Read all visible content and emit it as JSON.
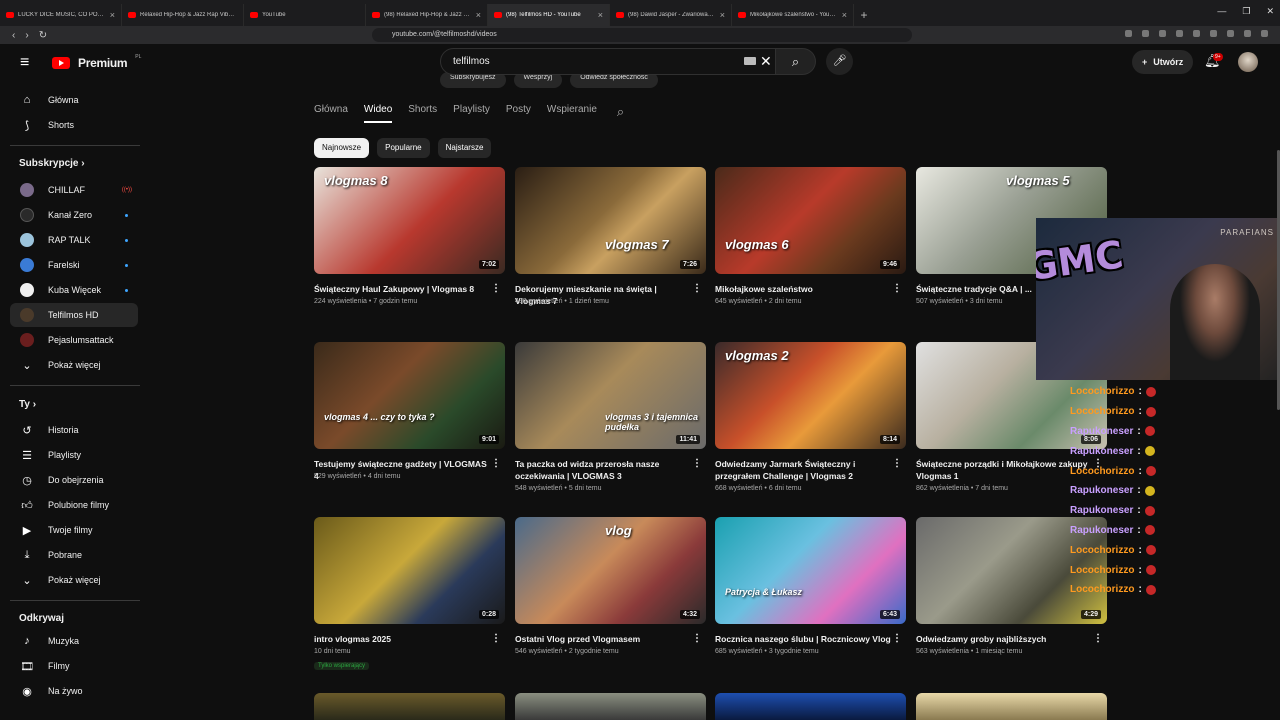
{
  "browser": {
    "tabs": [
      {
        "title": "LUCKY DICE MUSIC, CO POSZŁO NIE TAK"
      },
      {
        "title": "Relaxed Hip-Hop & Jazz Rap Vibes / Lo-fi"
      },
      {
        "title": "YouTube"
      },
      {
        "title": "(98) Relaxed Hip-Hop & Jazz Rap Vibes"
      },
      {
        "title": "(98) Telfilmos HD - YouTube"
      },
      {
        "title": "(98) Dawid Jasper - Zwariowana Noc"
      },
      {
        "title": "Mikołajkowe szaleństwo - YouTube"
      }
    ],
    "url": "youtube.com/@telfilmoshd/videos"
  },
  "header": {
    "brand": "Premium",
    "country": "PL",
    "search_value": "telfilmos",
    "create_label": "Utwórz",
    "notif_count": "9+"
  },
  "channel_actions": [
    "Subskrybujesz",
    "Wesprzyj",
    "Odwiedź społeczność"
  ],
  "sidebar": {
    "main": [
      {
        "label": "Główna",
        "icon": "home-icon"
      },
      {
        "label": "Shorts",
        "icon": "shorts-icon"
      }
    ],
    "subs_header": "Subskrypcje",
    "subs": [
      {
        "label": "CHILLAF",
        "color": "#7a6a8a",
        "status": "live"
      },
      {
        "label": "Kanał Zero",
        "color": "#2a2a2a",
        "status": "new"
      },
      {
        "label": "RAP TALK",
        "color": "#9cc4dc",
        "status": "new"
      },
      {
        "label": "Farelski",
        "color": "#3a7bd5",
        "status": "new"
      },
      {
        "label": "Kuba Więcek",
        "color": "#f0f0f0",
        "status": "new"
      },
      {
        "label": "Telfilmos HD",
        "color": "#4a3a2a",
        "status": ""
      },
      {
        "label": "Pejaslumsattack",
        "color": "#6a1e1e",
        "status": ""
      },
      {
        "label": "Pokaż więcej",
        "color": "",
        "status": ""
      }
    ],
    "you_header": "Ty",
    "you": [
      {
        "label": "Historia",
        "icon": "history-icon"
      },
      {
        "label": "Playlisty",
        "icon": "playlist-icon"
      },
      {
        "label": "Do obejrzenia",
        "icon": "watch-later-icon"
      },
      {
        "label": "Polubione filmy",
        "icon": "like-icon"
      },
      {
        "label": "Twoje filmy",
        "icon": "your-videos-icon"
      },
      {
        "label": "Pobrane",
        "icon": "download-icon"
      },
      {
        "label": "Pokaż więcej",
        "icon": "chevron-down-icon"
      }
    ],
    "explore_header": "Odkrywaj",
    "explore": [
      {
        "label": "Muzyka",
        "icon": "music-icon"
      },
      {
        "label": "Filmy",
        "icon": "film-icon"
      },
      {
        "label": "Na żywo",
        "icon": "live-icon"
      }
    ]
  },
  "channel_tabs": [
    "Główna",
    "Wideo",
    "Shorts",
    "Playlisty",
    "Posty",
    "Wspieranie"
  ],
  "filters": [
    "Najnowsze",
    "Popularne",
    "Najstarsze"
  ],
  "videos": [
    {
      "title": "Świąteczny Haul Zakupowy | Vlogmas 8",
      "views": "224 wyświetlenia",
      "age": "7 godzin temu",
      "duration": "7:02",
      "overlay": "vlogmas 8"
    },
    {
      "title": "Dekorujemy mieszkanie na święta | Vlogmas 7",
      "views": "430 wyświetleń",
      "age": "1 dzień temu",
      "duration": "7:26",
      "overlay": "vlogmas 7"
    },
    {
      "title": "Mikołajkowe szaleństwo",
      "views": "645 wyświetleń",
      "age": "2 dni temu",
      "duration": "9:46",
      "overlay": "vlogmas 6"
    },
    {
      "title": "Świąteczne tradycje Q&A | ...",
      "views": "507 wyświetleń",
      "age": "3 dni temu",
      "duration": "",
      "overlay": "vlogmas 5"
    },
    {
      "title": "Testujemy świąteczne gadżety | VLOGMAS 4",
      "views": "529 wyświetleń",
      "age": "4 dni temu",
      "duration": "9:01",
      "overlay": "vlogmas 4 ... czy to tyka ?"
    },
    {
      "title": "Ta paczka od widza przerosła nasze oczekiwania | VLOGMAS 3",
      "views": "548 wyświetleń",
      "age": "5 dni temu",
      "duration": "11:41",
      "overlay": "vlogmas 3 i tajemnica pudełka"
    },
    {
      "title": "Odwiedzamy Jarmark Świąteczny i przegrałem Challenge | Vlogmas 2",
      "views": "668 wyświetleń",
      "age": "6 dni temu",
      "duration": "8:14",
      "overlay": "vlogmas 2"
    },
    {
      "title": "Świąteczne porządki i Mikołajkowe zakupy Vlogmas 1",
      "views": "862 wyświetlenia",
      "age": "7 dni temu",
      "duration": "8:06",
      "overlay": ""
    },
    {
      "title": "intro vlogmas 2025",
      "views": "10 dni temu",
      "age": "",
      "duration": "0:28",
      "overlay": "",
      "badge": "Tylko wspierający"
    },
    {
      "title": "Ostatni Vlog przed Vlogmasem",
      "views": "546 wyświetleń",
      "age": "2 tygodnie temu",
      "duration": "4:32",
      "overlay": "vlog"
    },
    {
      "title": "Rocznica naszego ślubu | Rocznicowy Vlog",
      "views": "685 wyświetleń",
      "age": "3 tygodnie temu",
      "duration": "6:43",
      "overlay": "Patrycja & Łukasz"
    },
    {
      "title": "Odwiedzamy groby najbliższych",
      "views": "563 wyświetlenia",
      "age": "1 miesiąc temu",
      "duration": "4:29",
      "overlay": ""
    }
  ],
  "stream_overlay": {
    "logo_text": "GMC",
    "banner": "PARAFIANS",
    "chat": [
      {
        "user": "Locochorizzo",
        "color": "#ff9a1f"
      },
      {
        "user": "Locochorizzo",
        "color": "#ff9a1f"
      },
      {
        "user": "Rapukoneser",
        "color": "#c9a0ff"
      },
      {
        "user": "Rapukoneser",
        "color": "#c9a0ff"
      },
      {
        "user": "Locochorizzo",
        "color": "#ff9a1f"
      },
      {
        "user": "Rapukoneser",
        "color": "#c9a0ff"
      },
      {
        "user": "Rapukoneser",
        "color": "#c9a0ff"
      },
      {
        "user": "Rapukoneser",
        "color": "#c9a0ff"
      },
      {
        "user": "Locochorizzo",
        "color": "#ff9a1f"
      },
      {
        "user": "Locochorizzo",
        "color": "#ff9a1f"
      },
      {
        "user": "Locochorizzo",
        "color": "#ff9a1f"
      }
    ]
  }
}
